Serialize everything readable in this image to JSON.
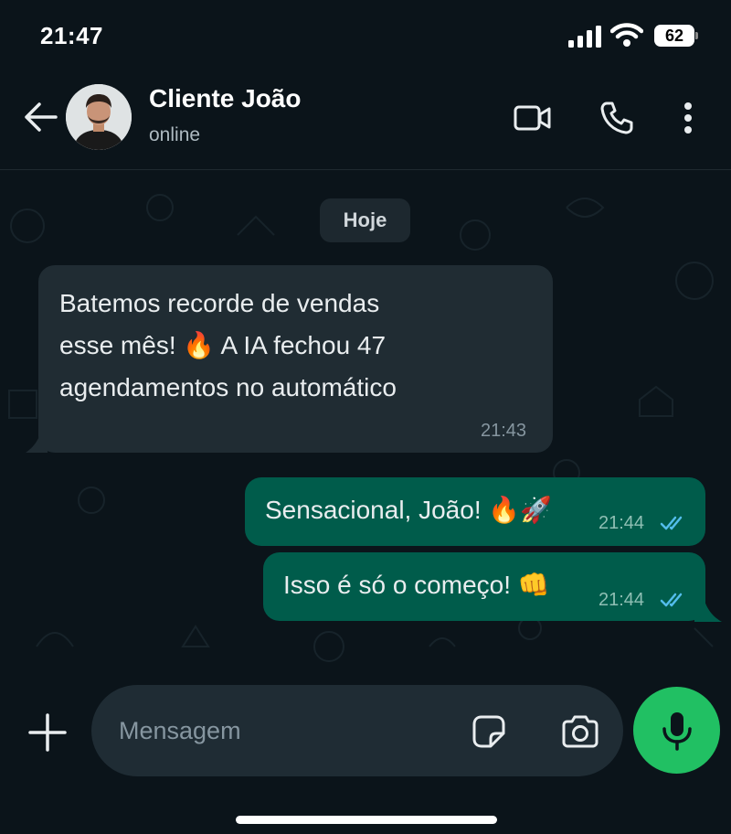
{
  "status_bar": {
    "time": "21:47",
    "battery": "62"
  },
  "header": {
    "contact_name": "Cliente João",
    "contact_status": "online"
  },
  "chat": {
    "date_chip": "Hoje",
    "messages": [
      {
        "direction": "incoming",
        "lines": [
          "Batemos recorde de vendas",
          "esse mês! 🔥  A IA fechou 47",
          "agendamentos no automático"
        ],
        "time": "21:43"
      },
      {
        "direction": "outgoing",
        "text": "Sensacional, João! 🔥🚀",
        "time": "21:44",
        "status": "read"
      },
      {
        "direction": "outgoing",
        "text": "Isso é só o começo! 👊",
        "time": "21:44",
        "status": "read"
      }
    ]
  },
  "input": {
    "placeholder": "Mensagem"
  },
  "colors": {
    "background": "#0b141a",
    "incoming_bubble": "#202c33",
    "outgoing_bubble": "#005c4b",
    "read_ticks": "#53bdeb",
    "mic_button": "#21c063"
  },
  "icons": {
    "back": "arrow-left-icon",
    "video": "video-camera-icon",
    "call": "phone-icon",
    "menu": "kebab-menu-icon",
    "plus": "plus-icon",
    "sticker": "sticker-icon",
    "camera": "camera-icon",
    "mic": "microphone-icon"
  }
}
